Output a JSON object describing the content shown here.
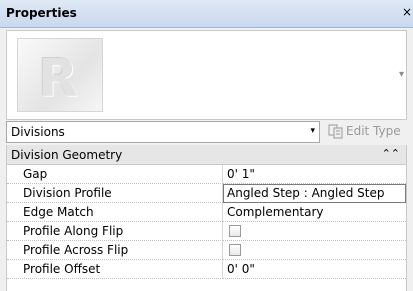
{
  "window": {
    "title": "Properties",
    "close_glyph": "×"
  },
  "preview": {
    "thumbnail_icon": "revit-logo-icon",
    "arrow_glyph": "▾"
  },
  "type_selector": {
    "value": "Divisions",
    "arrow_glyph": "▾"
  },
  "edit_type": {
    "label": "Edit Type",
    "icon": "edit-type-icon"
  },
  "group": {
    "label": "Division Geometry",
    "toggle_glyph": "⌃⌃"
  },
  "properties": [
    {
      "name": "Gap",
      "value": "0'  1\""
    },
    {
      "name": "Division Profile",
      "value": "Angled Step : Angled Step"
    },
    {
      "name": "Edge Match",
      "value": "Complementary"
    },
    {
      "name": "Profile Along Flip",
      "checked": false
    },
    {
      "name": "Profile Across Flip",
      "checked": false
    },
    {
      "name": "Profile Offset",
      "value": "0'  0\""
    }
  ]
}
